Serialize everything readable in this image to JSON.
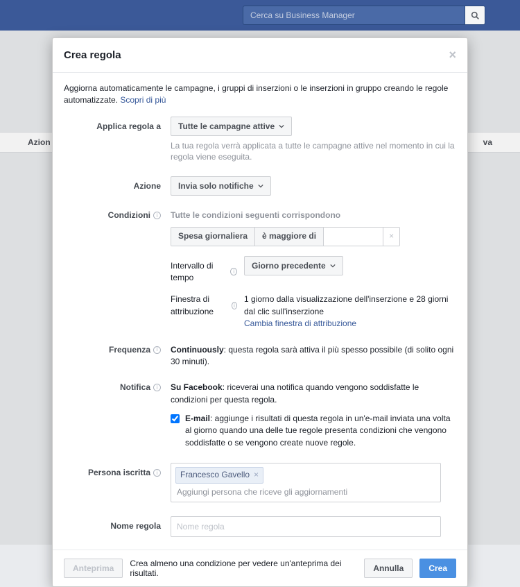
{
  "topbar": {
    "search_placeholder": "Cerca su Business Manager"
  },
  "behind": {
    "col1": "Azion",
    "col2": "va"
  },
  "modal": {
    "title": "Crea regola",
    "intro_text": "Aggiorna automaticamente le campagne, i gruppi di inserzioni o le inserzioni in gruppo creando le regole automatizzate. ",
    "intro_link": "Scopri di più",
    "labels": {
      "apply_to": "Applica regola a",
      "action": "Azione",
      "conditions": "Condizioni",
      "time_range": "Intervallo di tempo",
      "attrib_window": "Finestra di attribuzione",
      "frequency": "Frequenza",
      "notify": "Notifica",
      "subscriber": "Persona iscritta",
      "rule_name": "Nome regola"
    },
    "apply_to": {
      "selected": "Tutte le campagne attive",
      "hint": "La tua regola verrà applicata a tutte le campagne attive nel momento in cui la regola viene eseguita."
    },
    "action": {
      "selected": "Invia solo notifiche"
    },
    "conditions": {
      "header": "Tutte le condizioni seguenti corrispondono",
      "metric": "Spesa giornaliera",
      "operator": "è maggiore di",
      "value": ""
    },
    "time_range": {
      "selected": "Giorno precedente"
    },
    "attrib": {
      "text": "1 giorno dalla visualizzazione dell'inserzione e 28 giorni dal clic sull'inserzione",
      "change_link": "Cambia finestra di attribuzione"
    },
    "frequency": {
      "bold": "Continuously",
      "text": ": questa regola sarà attiva il più spesso possibile (di solito ogni 30 minuti)."
    },
    "notify": {
      "fb_bold": "Su Facebook",
      "fb_text": ": riceverai una notifica quando vengono soddisfatte le condizioni per questa regola.",
      "email_checked": true,
      "email_bold": "E-mail",
      "email_text": ": aggiunge i risultati di questa regola in un'e-mail inviata una volta al giorno quando una delle tue regole presenta condizioni che vengono soddisfatte o se vengono create nuove regole."
    },
    "subscriber": {
      "tokens": [
        "Francesco Gavello"
      ],
      "placeholder": "Aggiungi persona che riceve gli aggiornamenti"
    },
    "rule_name": {
      "value": "",
      "placeholder": "Nome regola"
    }
  },
  "footer": {
    "preview": "Anteprima",
    "preview_hint": "Crea almeno una condizione per vedere un'anteprima dei risultati.",
    "cancel": "Annulla",
    "create": "Crea"
  }
}
